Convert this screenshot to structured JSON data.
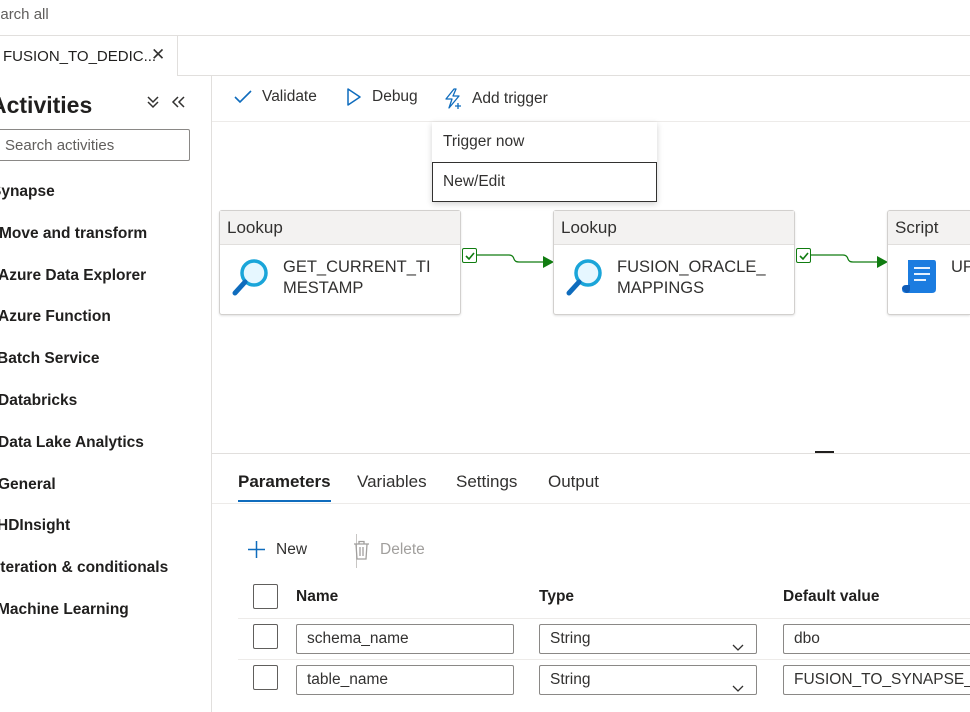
{
  "topbar": {
    "search_text": "Search all"
  },
  "tab": {
    "label": "FUSION_TO_DEDIC...",
    "close": "✕"
  },
  "sidebar": {
    "title": "Activities",
    "search_placeholder": "Search activities",
    "categories": [
      "Synapse",
      "Move and transform",
      "Azure Data Explorer",
      "Azure Function",
      "Batch Service",
      "Databricks",
      "Data Lake Analytics",
      "General",
      "HDInsight",
      "Iteration & conditionals",
      "Machine Learning"
    ]
  },
  "toolbar": {
    "validate": "Validate",
    "debug": "Debug",
    "add_trigger": "Add trigger"
  },
  "trigger_menu": {
    "items": [
      "Trigger now",
      "New/Edit"
    ]
  },
  "pipeline": {
    "nodes": [
      {
        "type": "Lookup",
        "name": "GET_CURRENT_TIMESTAMP",
        "icon": "lookup-icon"
      },
      {
        "type": "Lookup",
        "name": "FUSION_ORACLE_MAPPINGS",
        "icon": "lookup-icon"
      },
      {
        "type": "Script",
        "name": "UPDATE_CONFIGURATION",
        "icon": "script-icon"
      }
    ]
  },
  "panel": {
    "tabs": [
      "Parameters",
      "Variables",
      "Settings",
      "Output"
    ],
    "active_tab": "Parameters",
    "new_label": "New",
    "delete_label": "Delete",
    "columns": [
      "Name",
      "Type",
      "Default value"
    ],
    "rows": [
      {
        "name": "schema_name",
        "type": "String",
        "default": "dbo"
      },
      {
        "name": "table_name",
        "type": "String",
        "default": "FUSION_TO_SYNAPSE_SCHEMA"
      }
    ]
  },
  "colors": {
    "accent": "#0f6cbd",
    "success": "#107c10",
    "border": "#e1dfdd"
  }
}
